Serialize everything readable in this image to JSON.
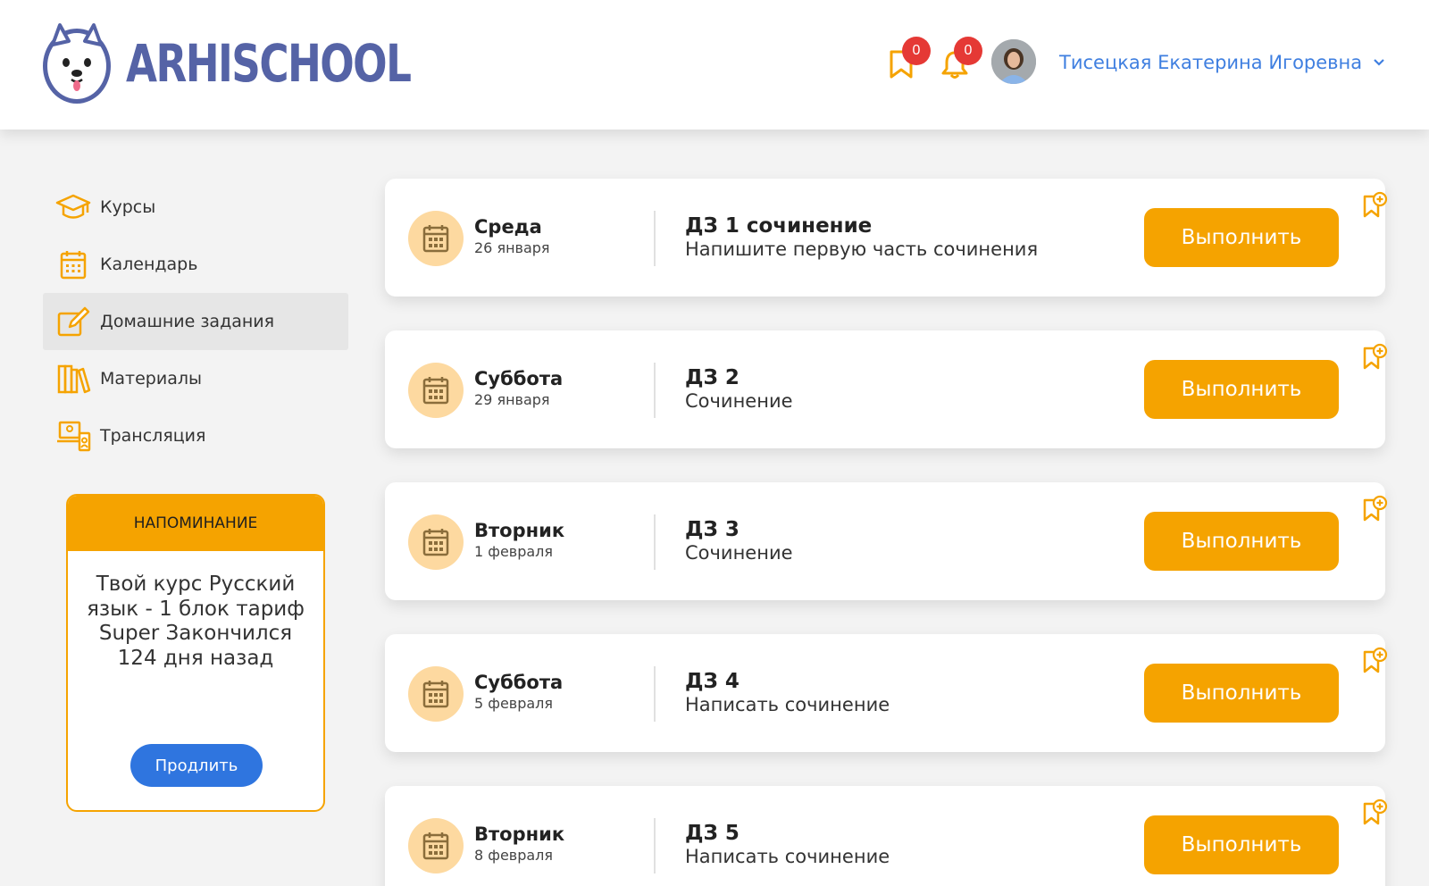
{
  "header": {
    "logo_text": "ARHISCHOOL",
    "bookmarks_count": "0",
    "notifications_count": "0",
    "user_name": "Тисецкая Екатерина Игоревна"
  },
  "sidebar": {
    "items": [
      {
        "label": "Курсы",
        "icon": "graduation-cap-icon"
      },
      {
        "label": "Календарь",
        "icon": "calendar-icon"
      },
      {
        "label": "Домашние задания",
        "icon": "edit-icon",
        "active": true
      },
      {
        "label": "Материалы",
        "icon": "books-icon"
      },
      {
        "label": "Трансляция",
        "icon": "broadcast-icon"
      }
    ]
  },
  "reminder": {
    "title": "НАПОМИНАНИЕ",
    "text": "Твой курс Русский язык - 1 блок тариф Super Закончился 124 дня назад",
    "button": "Продлить"
  },
  "homework": [
    {
      "day": "Среда",
      "date": "26 января",
      "title": "ДЗ 1 сочинение",
      "desc": "Напишите первую часть сочинения",
      "button": "Выполнить"
    },
    {
      "day": "Суббота",
      "date": "29 января",
      "title": "ДЗ 2",
      "desc": "Сочинение",
      "button": "Выполнить"
    },
    {
      "day": "Вторник",
      "date": "1 февраля",
      "title": "ДЗ 3",
      "desc": "Сочинение",
      "button": "Выполнить"
    },
    {
      "day": "Суббота",
      "date": "5 февраля",
      "title": "ДЗ 4",
      "desc": "Написать сочинение",
      "button": "Выполнить"
    },
    {
      "day": "Вторник",
      "date": "8 февраля",
      "title": "ДЗ 5",
      "desc": "Написать сочинение",
      "button": "Выполнить"
    }
  ],
  "colors": {
    "accent": "#f5a300",
    "brand": "#5563a6",
    "link": "#3f7fe0",
    "primary_button": "#2f75df",
    "badge": "#e53935"
  }
}
